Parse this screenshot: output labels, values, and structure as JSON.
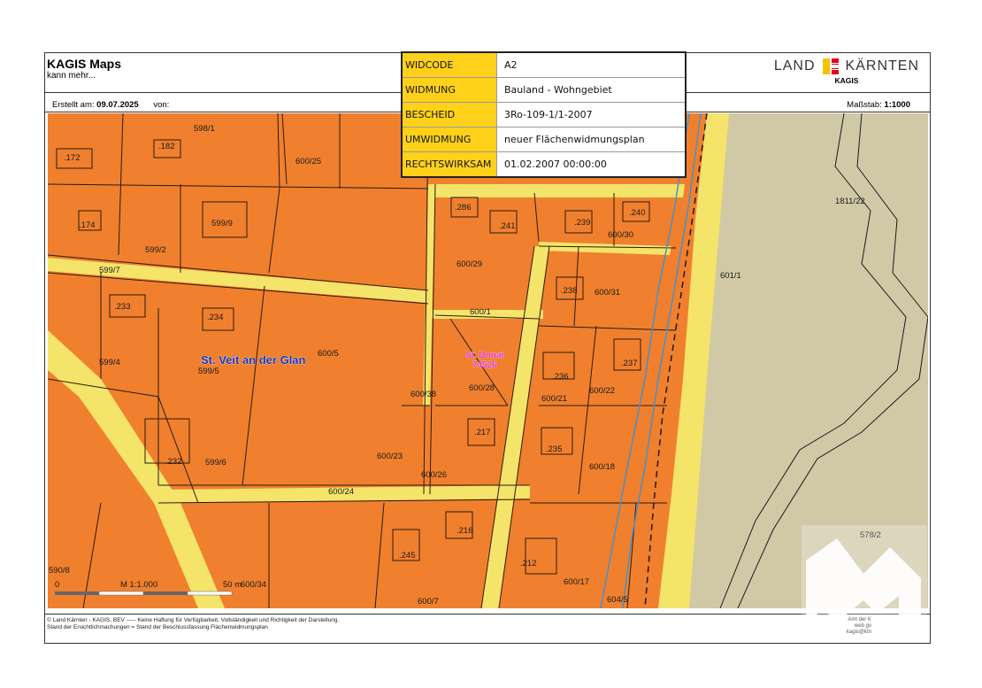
{
  "header": {
    "title": "KAGIS Maps",
    "tagline": "kann mehr...",
    "created_label": "Erstellt am:",
    "created_date": "09.07.2025",
    "from_label": "von:",
    "scale_label": "Maßstab:",
    "scale_value": "1:1000"
  },
  "brand": {
    "left": "LAND",
    "right": "KÄRNTEN",
    "sub": "KAGIS",
    "colors": {
      "yellow": "#f5c400",
      "red": "#e2001a",
      "black": "#1a1a1a"
    }
  },
  "info": {
    "rows": [
      {
        "key": "WIDCODE",
        "value": "A2"
      },
      {
        "key": "WIDMUNG",
        "value": "Bauland - Wohngebiet"
      },
      {
        "key": "BESCHEID",
        "value": "3Ro-109-1/1-2007"
      },
      {
        "key": "UMWIDMUNG",
        "value": "neuer Flächenwidmungsplan"
      },
      {
        "key": "RECHTSWIRKSAM",
        "value": "01.02.2007 00:00:00"
      }
    ],
    "key_color": "#ffd11a"
  },
  "map": {
    "colors": {
      "bauland": "#f0802e",
      "verkehr": "#f4e46a",
      "parcel_line": "#2a1a10",
      "water": "#4a90c8",
      "gruenland": "#c9c09a"
    },
    "town_label": "St. Veit an der Glan",
    "cadastral_label": "St. Donat\n74526",
    "parcels": [
      "598/1",
      ".182",
      ".172",
      "600/25",
      ".174",
      "599/9",
      "599/2",
      "599/7",
      ".286",
      ".241",
      ".239",
      ".240",
      "600/30",
      "600/29",
      "1811/22",
      "601/1",
      ".233",
      ".234",
      ".238",
      "600/31",
      "600/1",
      "599/4",
      "599/5",
      "600/5",
      ".237",
      ".236",
      "600/22",
      "600/38",
      "600/28",
      "600/21",
      ".217",
      ".235",
      ".232",
      "599/6",
      "600/23",
      "600/26",
      "600/18",
      "600/24",
      ".216",
      ".245",
      ".212",
      "578/2",
      "590/8",
      "600/34",
      "600/17",
      "600/7",
      "604/5"
    ],
    "scalebar": {
      "start": "0",
      "middle": "M 1:1.000",
      "end": "50 m"
    }
  },
  "footer": {
    "line1": "© Land Kärnten - KAGIS, BEV ----- Keine Haftung für Verfügbarkeit, Vollständigkeit und Richtigkeit der Darstellung.",
    "line2": "Stand der Ersichtlichmachungen = Stand der Beschlussfassung Flächenwidmungsplan",
    "right1": "Amt der K",
    "right2": "web",
    "right3": "kagis@ktn",
    "right_g": "gv"
  }
}
